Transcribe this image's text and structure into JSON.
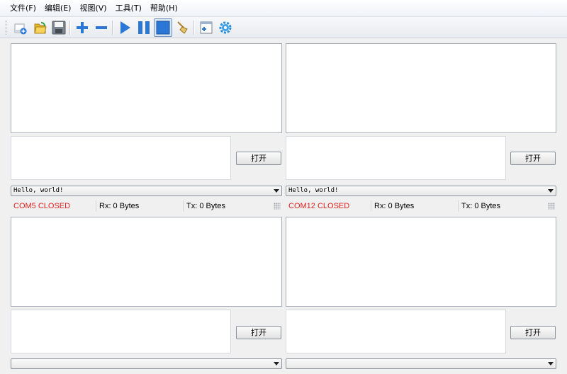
{
  "menu": {
    "file": "文件(F)",
    "edit": "编辑(E)",
    "view": "视图(V)",
    "tools": "工具(T)",
    "help": "帮助(H)"
  },
  "toolbar": {
    "icons": [
      "new-icon",
      "open-folder-icon",
      "save-icon",
      "add-icon",
      "remove-icon",
      "play-icon",
      "pause-icon",
      "stop-icon",
      "clear-broom-icon",
      "new-window-icon",
      "settings-gear-icon"
    ]
  },
  "colors": {
    "status_closed": "#e02020",
    "icon_blue": "#2a77d6"
  },
  "panels": {
    "top_left": {
      "open_label": "打开",
      "combo_value": "Hello, world!",
      "port_status": "COM5 CLOSED",
      "rx": "Rx: 0 Bytes",
      "tx": "Tx: 0 Bytes"
    },
    "top_right": {
      "open_label": "打开",
      "combo_value": "Hello, world!",
      "port_status": "COM12 CLOSED",
      "rx": "Rx: 0 Bytes",
      "tx": "Tx: 0 Bytes"
    },
    "bottom_left": {
      "open_label": "打开",
      "combo_value": ""
    },
    "bottom_right": {
      "open_label": "打开",
      "combo_value": ""
    }
  }
}
